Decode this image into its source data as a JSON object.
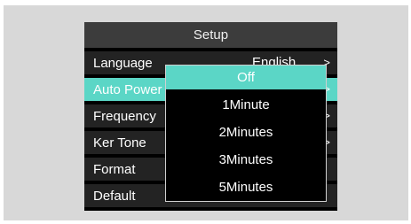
{
  "setup": {
    "title": "Setup",
    "items": [
      {
        "label": "Language",
        "value": "English",
        "arrow": ">"
      },
      {
        "label": "Auto Power Off",
        "value": "",
        "arrow": ">"
      },
      {
        "label": "Frequency",
        "value": "",
        "arrow": ">"
      },
      {
        "label": "Ker Tone",
        "value": "",
        "arrow": ">"
      },
      {
        "label": "Format",
        "value": "",
        "arrow": ""
      },
      {
        "label": "Default",
        "value": "",
        "arrow": ""
      }
    ],
    "selected_index": 1
  },
  "popup": {
    "options": [
      "Off",
      "1Minute",
      "2Minutes",
      "3Minutes",
      "5Minutes"
    ],
    "selected_index": 0
  },
  "colors": {
    "highlight": "#5bd6c6",
    "header_bg": "#3c3c3c",
    "row_bg": "#232323"
  }
}
